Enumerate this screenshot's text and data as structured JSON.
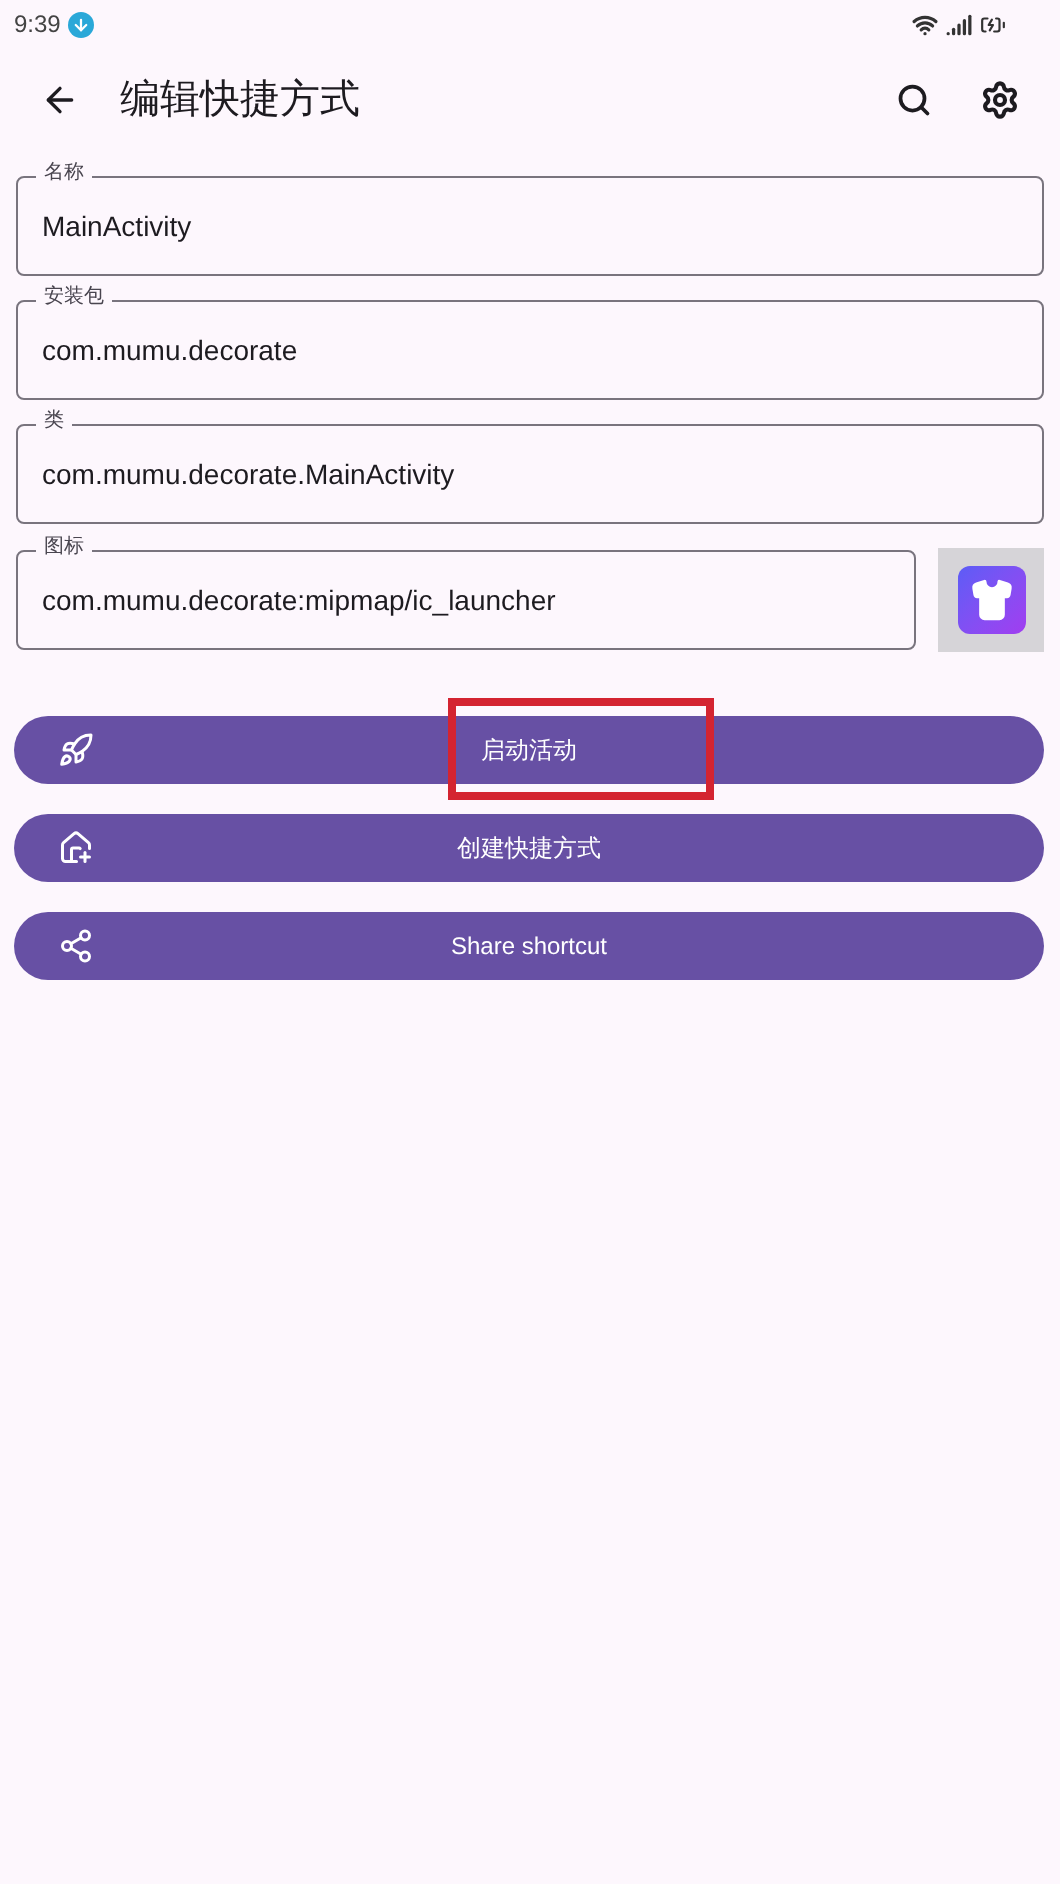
{
  "status_bar": {
    "time": "9:39"
  },
  "app_bar": {
    "title": "编辑快捷方式"
  },
  "fields": [
    {
      "label": "名称",
      "value": "MainActivity"
    },
    {
      "label": "安装包",
      "value": "com.mumu.decorate"
    },
    {
      "label": "类",
      "value": "com.mumu.decorate.MainActivity"
    },
    {
      "label": "图标",
      "value": "com.mumu.decorate:mipmap/ic_launcher",
      "kind": "icon"
    }
  ],
  "buttons": [
    {
      "label": "启动活动",
      "kind": "launch",
      "highlighted": true
    },
    {
      "label": "创建快捷方式",
      "kind": "create",
      "highlighted": false
    },
    {
      "label": "Share shortcut",
      "kind": "share",
      "highlighted": false
    }
  ]
}
